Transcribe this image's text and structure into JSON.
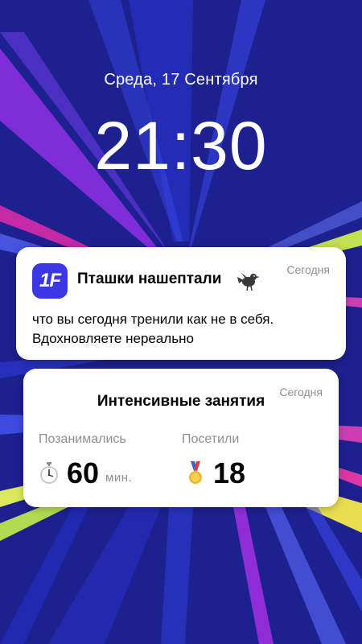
{
  "lockscreen": {
    "date": "Среда, 17 Сентября",
    "time": "21:30"
  },
  "notification": {
    "app_icon_text": "1F",
    "title": "Пташки нашептали",
    "title_emoji": "bird-icon",
    "timestamp": "Сегодня",
    "body": "что вы сегодня тренили как не в себя. Вдохновляете нереально",
    "accent_color": "#3b37e6"
  },
  "widget": {
    "title": "Интенсивные занятия",
    "timestamp": "Сегодня",
    "stats": [
      {
        "label": "Позанимались",
        "icon": "stopwatch-icon",
        "value": "60",
        "unit": "мин."
      },
      {
        "label": "Посетили",
        "icon": "medal-icon",
        "value": "18"
      }
    ]
  },
  "colors": {
    "wallpaper": "#1c1f8c",
    "card": "#ffffff",
    "secondary_text": "#8e8e93"
  }
}
